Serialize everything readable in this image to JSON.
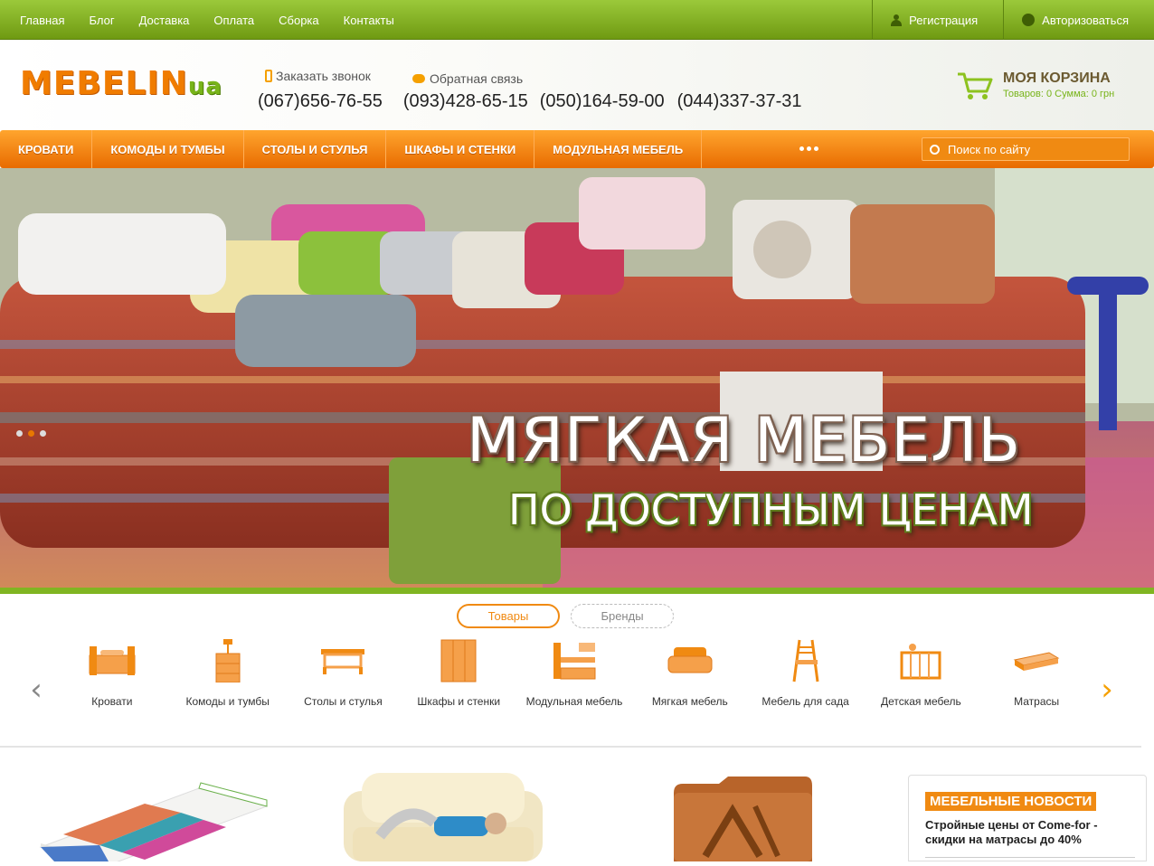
{
  "topnav": {
    "items": [
      "Главная",
      "Блог",
      "Доставка",
      "Оплата",
      "Сборка",
      "Контакты"
    ],
    "register": "Регистрация",
    "login": "Авторизоваться"
  },
  "header": {
    "logo": "MEBELIN",
    "logo_suffix": "ua",
    "callback": "Заказать звонок",
    "feedback": "Обратная связь",
    "phones": [
      "(067)656-76-55",
      "(093)428-65-15",
      "(050)164-59-00",
      "(044)337-37-31"
    ],
    "cart_title": "МОЯ КОРЗИНА",
    "cart_info": "Товаров: 0   Сумма: 0 грн"
  },
  "menu": {
    "items": [
      "КРОВАТИ",
      "КОМОДЫ И ТУМБЫ",
      "СТОЛЫ И СТУЛЬЯ",
      "ШКАФЫ И СТЕНКИ",
      "МОДУЛЬНАЯ МЕБЕЛЬ"
    ],
    "search_placeholder": "Поиск по сайту"
  },
  "hero": {
    "title": "МЯГКАЯ МЕБЕЛЬ",
    "subtitle": "ПО ДОСТУПНЫМ ЦЕНАМ",
    "slides": 3,
    "active_slide": 2
  },
  "tabs": {
    "goods": "Товары",
    "brands": "Бренды"
  },
  "categories": [
    {
      "label": "Кровати",
      "icon": "bed-icon"
    },
    {
      "label": "Комоды и тумбы",
      "icon": "dresser-icon"
    },
    {
      "label": "Столы и стулья",
      "icon": "table-icon"
    },
    {
      "label": "Шкафы и стенки",
      "icon": "wardrobe-icon"
    },
    {
      "label": "Модульная мебель",
      "icon": "modular-icon"
    },
    {
      "label": "Мягкая мебель",
      "icon": "sofa-icon"
    },
    {
      "label": "Мебель для сада",
      "icon": "garden-chair-icon"
    },
    {
      "label": "Детская мебель",
      "icon": "crib-icon"
    },
    {
      "label": "Матрасы",
      "icon": "mattress-icon"
    }
  ],
  "news": {
    "heading": "МЕБЕЛЬНЫЕ НОВОСТИ",
    "item": "Стройные цены от Come-for - скидки на матрасы до 40%"
  },
  "colors": {
    "orange": "#f08a12",
    "green": "#78b41a"
  }
}
